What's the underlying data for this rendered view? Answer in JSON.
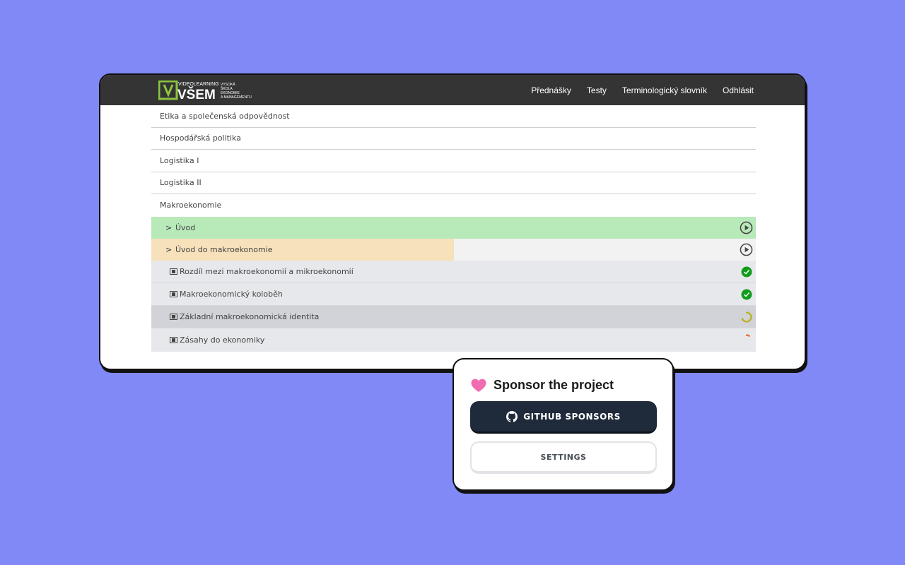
{
  "header": {
    "logo_text": {
      "top": "VIDEOLEARNING",
      "main": "VŠEM",
      "side": [
        "VYSOKÁ",
        "ŠKOLA",
        "EKONOMIE",
        "A MANAGEMENTU"
      ]
    },
    "nav": [
      "Přednášky",
      "Testy",
      "Terminologický slovník",
      "Odhlásit"
    ]
  },
  "courses": [
    "Etika a společenská odpovědnost",
    "Hospodářská politika",
    "Logistika I",
    "Logistika II",
    "Makroekonomie"
  ],
  "chapters": [
    {
      "label": "Úvod",
      "status": "done",
      "progress": 1.0
    },
    {
      "label": "Úvod do makroekonomie",
      "status": "in-progress",
      "progress": 0.5
    }
  ],
  "videos": [
    {
      "label": "Rozdíl mezi makroekonomií a mikroekonomií",
      "status": "complete"
    },
    {
      "label": "Makroekonomický koloběh",
      "status": "complete"
    },
    {
      "label": "Základní makroekonomická identita",
      "status": "partial",
      "progress": 0.7
    },
    {
      "label": "Zásahy do ekonomiky",
      "status": "partial",
      "progress": 0.1
    }
  ],
  "colors": {
    "complete": "#0f9d1a",
    "partial_high": "#b8b21d",
    "partial_low": "#e8682a",
    "heart": "#f06bb0"
  },
  "sponsor": {
    "title": "Sponsor the project",
    "github_label": "GITHUB SPONSORS",
    "settings_label": "SETTINGS"
  }
}
